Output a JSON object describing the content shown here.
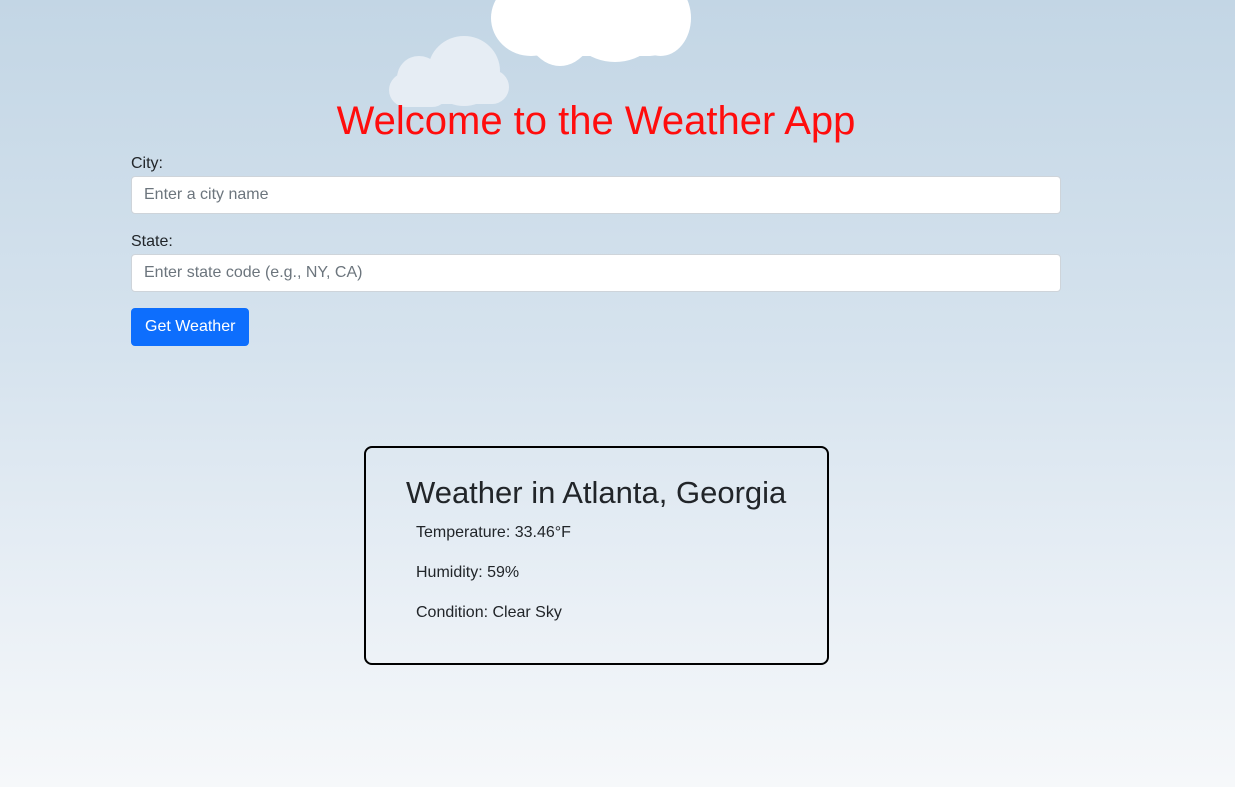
{
  "header": {
    "title": "Welcome to the Weather App"
  },
  "form": {
    "city_label": "City:",
    "city_placeholder": "Enter a city name",
    "city_value": "",
    "state_label": "State:",
    "state_placeholder": "Enter state code (e.g., NY, CA)",
    "state_value": "",
    "submit_label": "Get Weather"
  },
  "result": {
    "title": "Weather in Atlanta, Georgia",
    "temperature": "Temperature: 33.46°F",
    "humidity": "Humidity: 59%",
    "condition": "Condition: Clear Sky"
  },
  "colors": {
    "title": "#ff0d0d",
    "button": "#0d6efd",
    "background_top": "#c3d6e5",
    "background_bottom": "#f6f8fa"
  },
  "icons": {
    "decor": [
      "cloud-icon",
      "cloud-icon"
    ]
  }
}
